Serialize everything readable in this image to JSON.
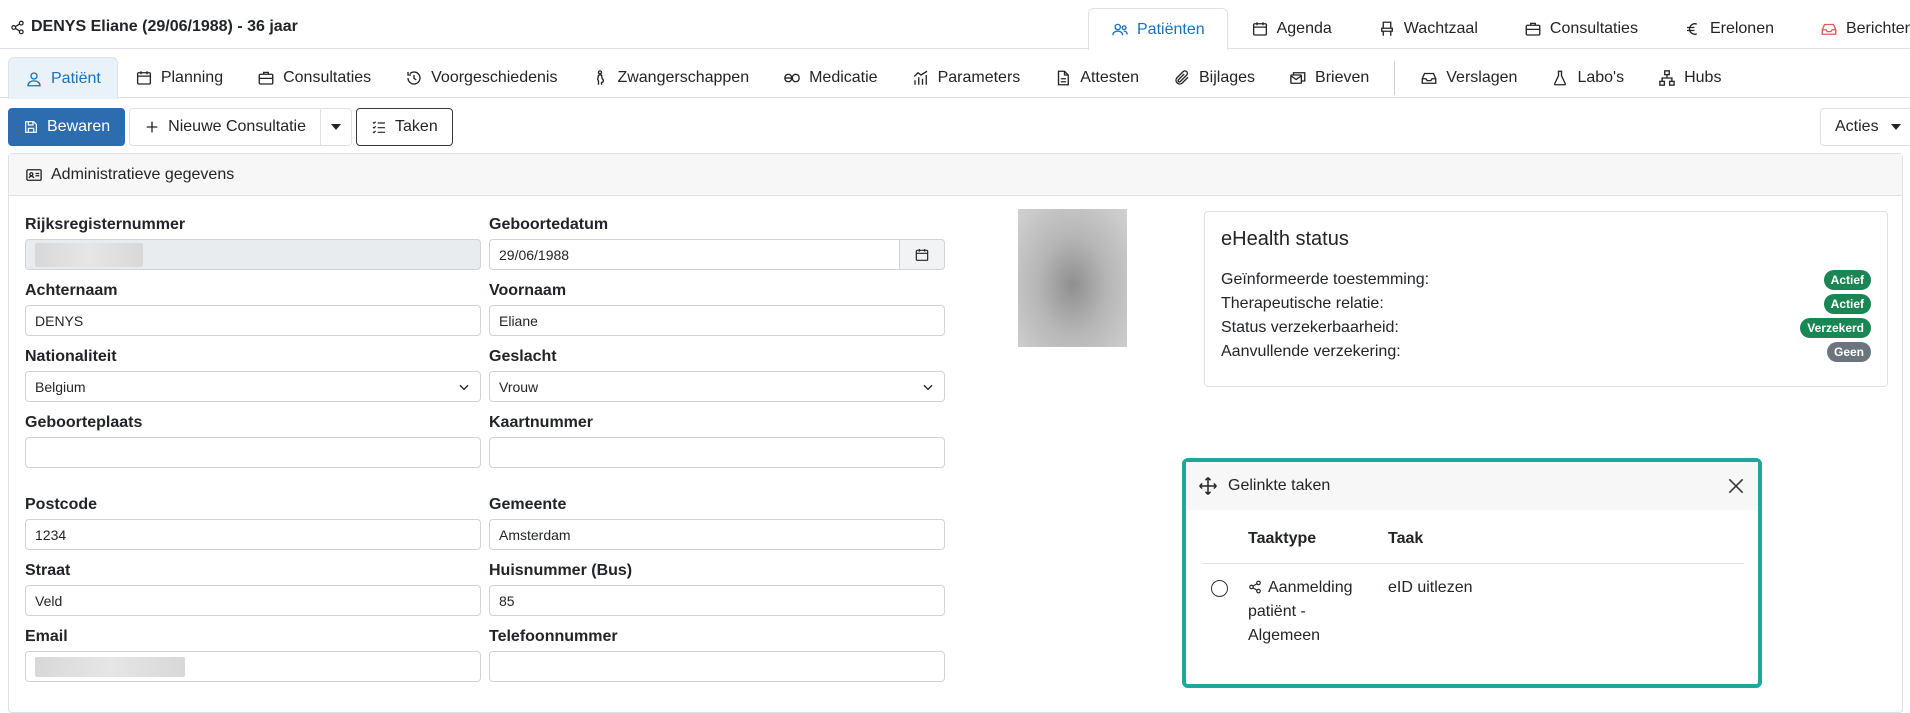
{
  "header": {
    "patient_title": "DENYS Eliane (29/06/1988) - 36 jaar",
    "nav": [
      {
        "label": "Patiënten",
        "icon": "users-icon"
      },
      {
        "label": "Agenda",
        "icon": "calendar-icon"
      },
      {
        "label": "Wachtzaal",
        "icon": "chair-icon"
      },
      {
        "label": "Consultaties",
        "icon": "briefcase-icon"
      },
      {
        "label": "Erelonen",
        "icon": "euro-icon"
      },
      {
        "label": "Berichten",
        "icon": "inbox-icon"
      }
    ]
  },
  "tabs": [
    {
      "label": "Patiënt",
      "icon": "person-icon"
    },
    {
      "label": "Planning",
      "icon": "calendar-icon"
    },
    {
      "label": "Consultaties",
      "icon": "briefcase-icon"
    },
    {
      "label": "Voorgeschiedenis",
      "icon": "history-icon"
    },
    {
      "label": "Zwangerschappen",
      "icon": "pregnancy-icon"
    },
    {
      "label": "Medicatie",
      "icon": "pills-icon"
    },
    {
      "label": "Parameters",
      "icon": "chart-icon"
    },
    {
      "label": "Attesten",
      "icon": "document-icon"
    },
    {
      "label": "Bijlages",
      "icon": "paperclip-icon"
    },
    {
      "label": "Brieven",
      "icon": "letters-icon"
    },
    {
      "label": "Verslagen",
      "icon": "inbox-icon"
    },
    {
      "label": "Labo's",
      "icon": "flask-icon"
    },
    {
      "label": "Hubs",
      "icon": "network-icon"
    }
  ],
  "toolbar": {
    "save": "Bewaren",
    "new_consult": "Nieuwe Consultatie",
    "tasks": "Taken",
    "actions": "Acties"
  },
  "card": {
    "title": "Administratieve gegevens"
  },
  "fields": {
    "rrn": {
      "label": "Rijksregisternummer"
    },
    "dob": {
      "label": "Geboortedatum",
      "value": "29/06/1988"
    },
    "lastname": {
      "label": "Achternaam",
      "value": "DENYS"
    },
    "firstname": {
      "label": "Voornaam",
      "value": "Eliane"
    },
    "nationality": {
      "label": "Nationaliteit",
      "value": "Belgium"
    },
    "gender": {
      "label": "Geslacht",
      "value": "Vrouw"
    },
    "birthplace": {
      "label": "Geboorteplaats",
      "value": ""
    },
    "cardnumber": {
      "label": "Kaartnummer",
      "value": ""
    },
    "postcode": {
      "label": "Postcode",
      "value": "1234"
    },
    "city": {
      "label": "Gemeente",
      "value": "Amsterdam"
    },
    "street": {
      "label": "Straat",
      "value": "Veld"
    },
    "housenumber": {
      "label": "Huisnummer (Bus)",
      "value": "85"
    },
    "email": {
      "label": "Email"
    },
    "phone": {
      "label": "Telefoonnummer",
      "value": ""
    }
  },
  "ehealth": {
    "title": "eHealth status",
    "rows": [
      {
        "label": "Geïnformeerde toestemming:",
        "badge": "Actief",
        "color": "#198754"
      },
      {
        "label": "Therapeutische relatie:",
        "badge": "Actief",
        "color": "#198754"
      },
      {
        "label": "Status verzekerbaarheid:",
        "badge": "Verzekerd",
        "color": "#198754"
      },
      {
        "label": "Aanvullende verzekering:",
        "badge": "Geen",
        "color": "#6c757d"
      }
    ]
  },
  "linked_tasks": {
    "title": "Gelinkte taken",
    "col_type": "Taaktype",
    "col_task": "Taak",
    "rows": [
      {
        "type": "Aanmelding patiënt - Algemeen",
        "task": "eID uitlezen"
      }
    ]
  },
  "colors": {
    "primary": "#2e6cb0",
    "accent_teal": "#1fa79c",
    "active_tab": "#1a73b8"
  }
}
